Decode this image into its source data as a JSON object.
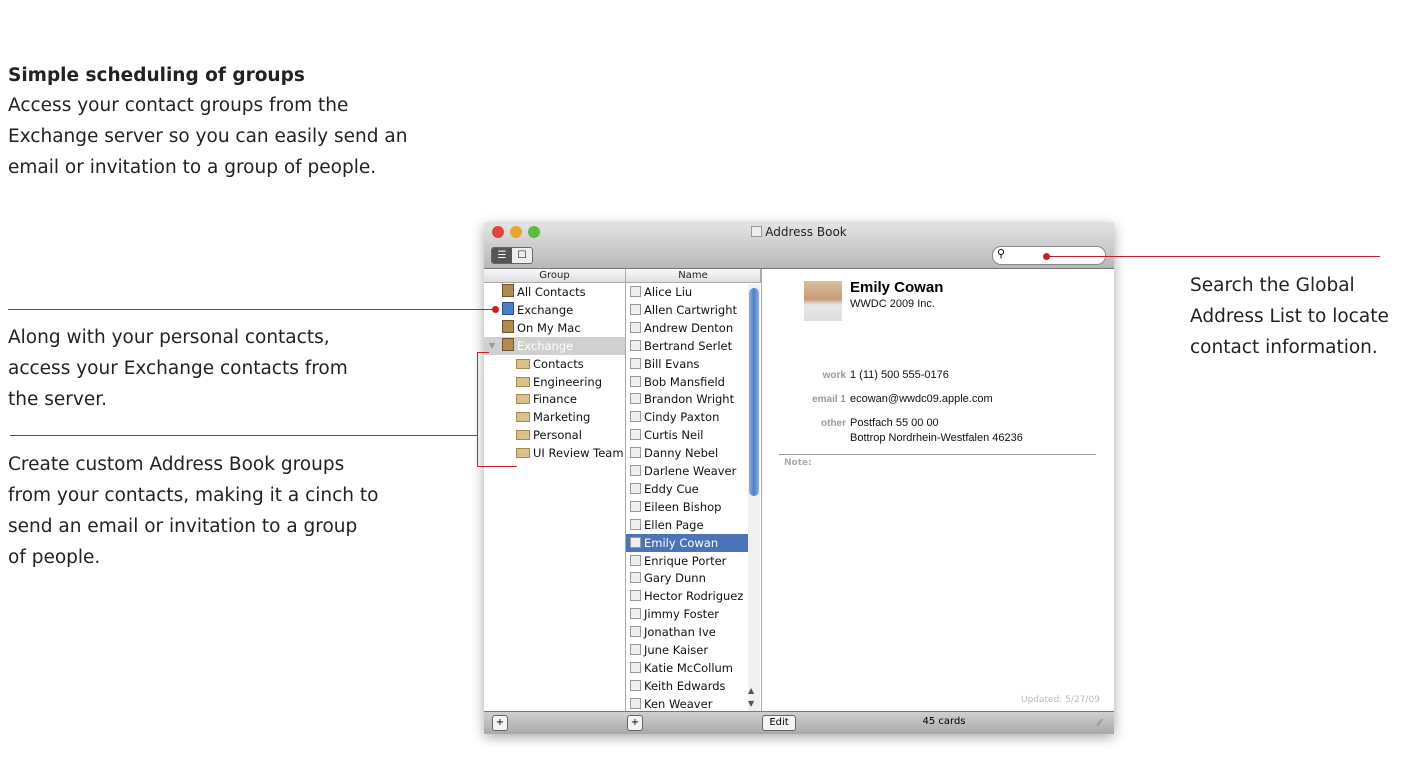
{
  "annotations": {
    "heading": "Simple scheduling of groups",
    "intro": [
      "Access your contact groups from the",
      "Exchange server so you can easily send an",
      "email or invitation to a group of people."
    ],
    "personal": [
      "Along with your personal contacts,",
      "access your Exchange contacts from",
      "the server."
    ],
    "custom": [
      "Create custom Address Book groups",
      "from your contacts, making it a cinch to",
      "send an email or invitation to a group",
      "of people."
    ],
    "search": [
      "Search the Global",
      "Address List to locate",
      "contact information."
    ]
  },
  "window": {
    "title": "Address Book",
    "search_placeholder": "",
    "group_header": "Group",
    "name_header": "Name"
  },
  "groups": [
    {
      "label": "All Contacts",
      "icon": "book"
    },
    {
      "label": "Exchange",
      "icon": "bookx"
    },
    {
      "label": "On My Mac",
      "icon": "book"
    },
    {
      "label": "Exchange",
      "icon": "book",
      "selected": true,
      "expanded": true
    },
    {
      "label": "Contacts",
      "icon": "folder",
      "indent": true
    },
    {
      "label": "Engineering",
      "icon": "folder",
      "indent": true
    },
    {
      "label": "Finance",
      "icon": "folder",
      "indent": true
    },
    {
      "label": "Marketing",
      "icon": "folder",
      "indent": true
    },
    {
      "label": "Personal",
      "icon": "folder",
      "indent": true
    },
    {
      "label": "UI Review Team",
      "icon": "folder",
      "indent": true
    }
  ],
  "names": [
    "Alice Liu",
    "Allen Cartwright",
    "Andrew Denton",
    "Bertrand Serlet",
    "Bill Evans",
    "Bob Mansfield",
    "Brandon Wright",
    "Cindy Paxton",
    "Curtis Neil",
    "Danny Nebel",
    "Darlene Weaver",
    "Eddy Cue",
    "Eileen Bishop",
    "Ellen Page",
    "Emily Cowan",
    "Enrique Porter",
    "Gary Dunn",
    "Hector Rodriguez",
    "Jimmy Foster",
    "Jonathan Ive",
    "June Kaiser",
    "Katie McCollum",
    "Keith Edwards",
    "Ken Weaver"
  ],
  "selected_name_index": 14,
  "card": {
    "name": "Emily Cowan",
    "company": "WWDC 2009 Inc.",
    "work_label": "work",
    "work": "1 (11) 500 555-0176",
    "email_label": "email 1",
    "email": "ecowan@wwdc09.apple.com",
    "other_label": "other",
    "other1": "Postfach 55 00 00",
    "other2": "Bottrop Nordrhein-Westfalen 46236",
    "note_label": "Note:",
    "updated": "Updated: 5/27/09"
  },
  "bottom": {
    "add": "+",
    "edit": "Edit",
    "count": "45 cards"
  },
  "colors": {
    "accent": "#c8202a",
    "selection": "#4a73b8"
  }
}
